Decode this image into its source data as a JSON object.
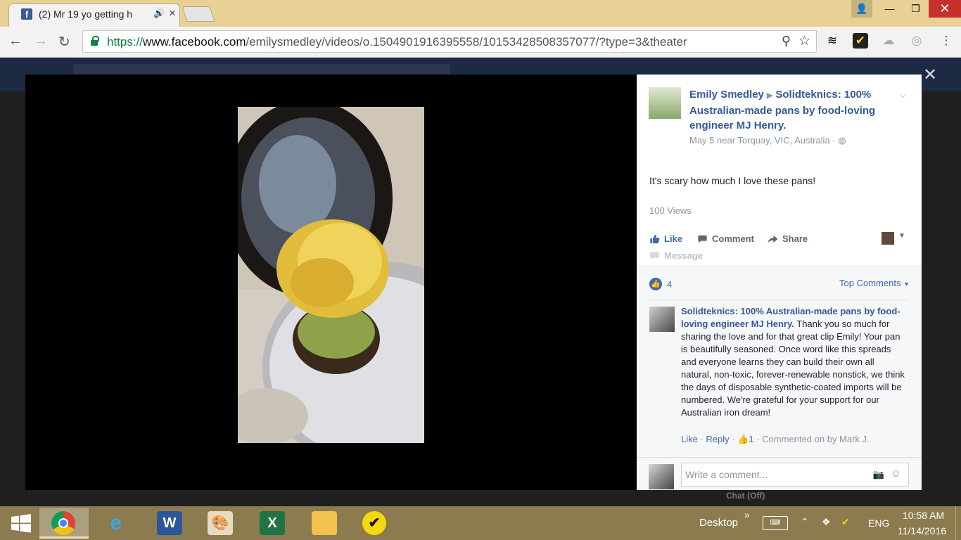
{
  "browser": {
    "tab_title": "(2) Mr 19 yo getting h",
    "url_prefix": "https://",
    "url_domain": "www.facebook.com",
    "url_path": "/emilysmedley/videos/o.1504901916395558/10153428508357077/?type=3&theater"
  },
  "post": {
    "author": "Emily Smedley",
    "target": "Solidteknics: 100% Australian-made pans by food-loving engineer MJ Henry.",
    "meta": "May 5 near Torquay, VIC, Australia ·",
    "text": "It's scary how much I love these pans!",
    "views": "100 Views",
    "actions": {
      "like": "Like",
      "comment": "Comment",
      "share": "Share",
      "message": "Message"
    }
  },
  "reactions": {
    "count": "4",
    "sort_label": "Top Comments"
  },
  "comment": {
    "author": "Solidteknics: 100% Australian-made pans by food-loving engineer MJ Henry.",
    "text": "Thank you so much for sharing the love and for that great clip Emily! Your pan is beautifully seasoned. Once word like this spreads and everyone learns they can build their own all natural, non-toxic, forever-renewable nonstick, we think the days of disposable synthetic-coated imports will be numbered. We're grateful for your support for our Australian iron dream!",
    "like": "Like",
    "reply": "Reply",
    "likes": "1",
    "commented_on": "· Commented on by Mark J."
  },
  "compose": {
    "placeholder": "Write a comment..."
  },
  "background": {
    "chat": "Chat (Off)"
  },
  "taskbar": {
    "desktop": "Desktop",
    "language": "ENG",
    "time": "10:58 AM",
    "date": "11/14/2016"
  },
  "colors": {
    "facebook_blue": "#4267b2",
    "link_blue": "#365899",
    "taskbar": "#8c7b4e",
    "titlebar": "#e7d195"
  }
}
